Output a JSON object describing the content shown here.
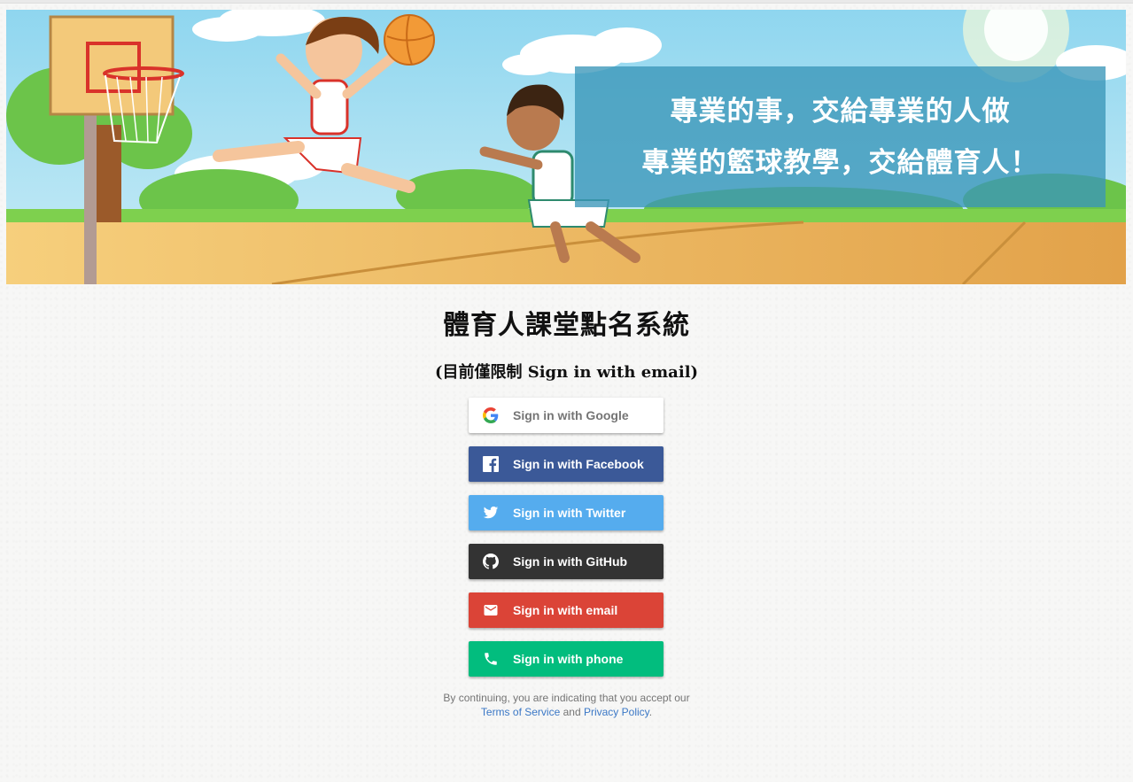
{
  "banner": {
    "line1": "專業的事，交給專業的人做",
    "line2": "專業的籃球教學，交給體育人！"
  },
  "page": {
    "title": "體育人課堂點名系統",
    "subtitle": "(目前僅限制 Sign in with email)"
  },
  "auth_buttons": {
    "google": "Sign in with Google",
    "facebook": "Sign in with Facebook",
    "twitter": "Sign in with Twitter",
    "github": "Sign in with GitHub",
    "email": "Sign in with email",
    "phone": "Sign in with phone"
  },
  "footer": {
    "prefix": "By continuing, you are indicating that you accept our",
    "terms": "Terms of Service",
    "and": "and",
    "privacy": "Privacy Policy",
    "suffix": "."
  },
  "colors": {
    "facebook": "#3b5998",
    "twitter": "#55acee",
    "github": "#333333",
    "email": "#db4437",
    "phone": "#02bd7e",
    "link": "#3b78c6"
  }
}
